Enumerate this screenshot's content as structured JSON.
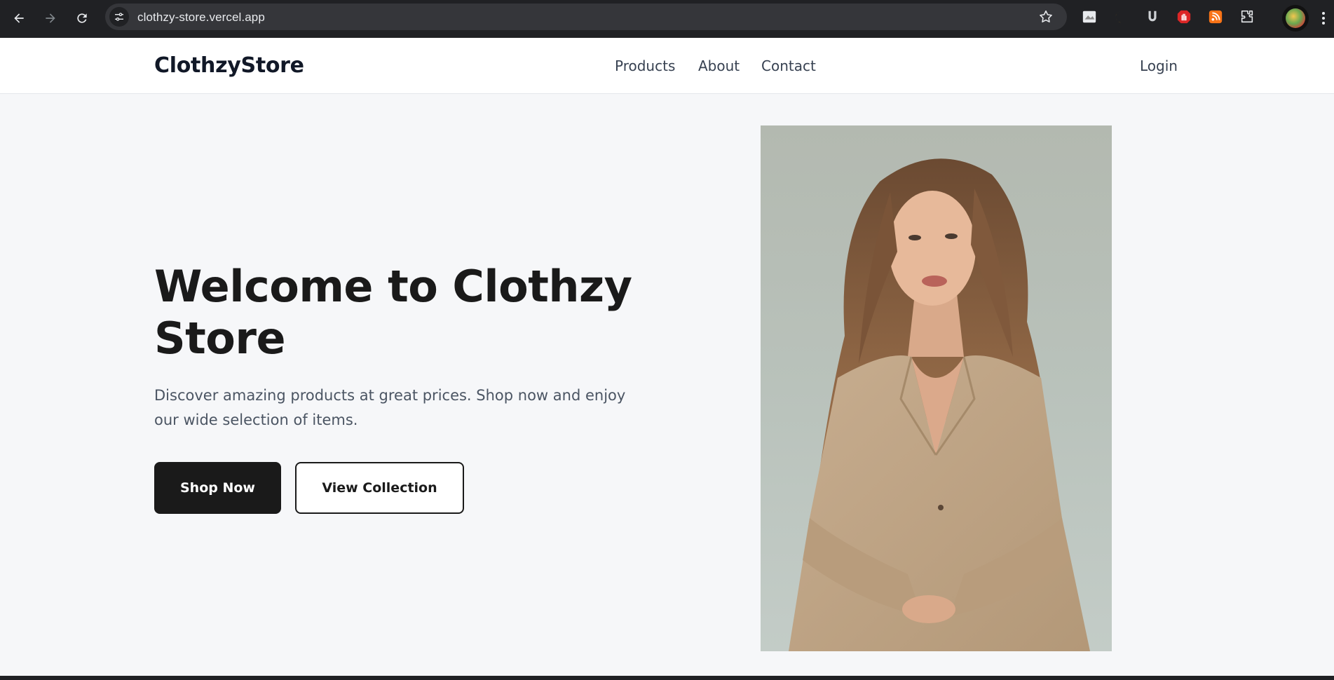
{
  "browser": {
    "url": "clothzy-store.vercel.app"
  },
  "header": {
    "logo": "ClothzyStore",
    "nav": [
      "Products",
      "About",
      "Contact"
    ],
    "login": "Login"
  },
  "hero": {
    "title": "Welcome to Clothzy Store",
    "description": "Discover amazing products at great prices. Shop now and enjoy our wide selection of items.",
    "primary_button": "Shop Now",
    "secondary_button": "View Collection"
  },
  "icons": {
    "back": "arrow-left-icon",
    "forward": "arrow-right-icon",
    "reload": "reload-icon",
    "site_info": "tune-icon",
    "bookmark": "star-icon",
    "extensions": [
      "screen-capture-extension-icon",
      "half-moon-extension-icon",
      "u-extension-icon",
      "stop-hand-extension-icon",
      "rss-extension-icon",
      "puzzle-icon"
    ],
    "menu": "kebab-menu-icon"
  },
  "colors": {
    "brand_dark": "#1a1a1a",
    "page_background": "#f6f7f9"
  }
}
